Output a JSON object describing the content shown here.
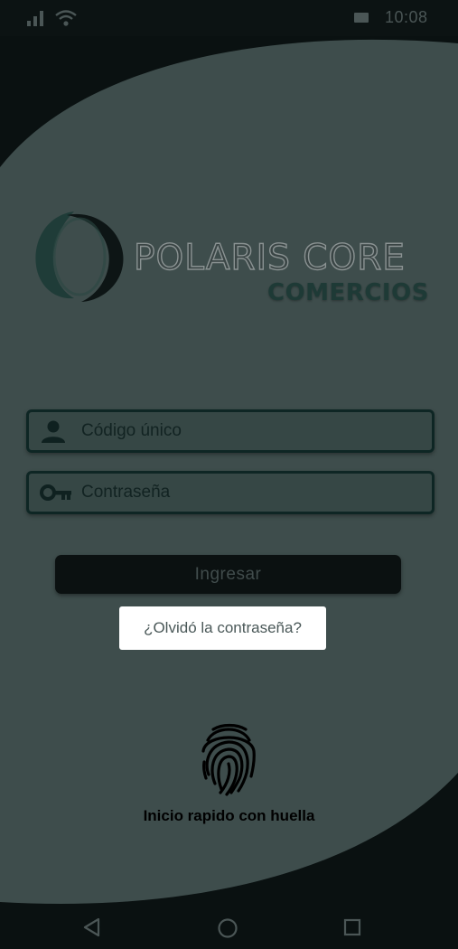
{
  "status_bar": {
    "time": "10:08",
    "signal_icon": "signal-icon",
    "wifi_icon": "wifi-icon",
    "battery_icon": "battery-icon"
  },
  "brand": {
    "title": "POLARIS CORE",
    "subtitle": "COMERCIOS",
    "logo_icon": "polaris-logo-icon"
  },
  "login_form": {
    "user_placeholder": "Código único",
    "user_icon": "person-icon",
    "password_placeholder": "Contraseña",
    "password_icon": "key-icon",
    "submit_label": "Ingresar",
    "forgot_label": "¿Olvidó la contraseña?"
  },
  "fingerprint": {
    "icon": "fingerprint-icon",
    "label": "Inicio rapido con huella"
  },
  "nav_bar": {
    "back_icon": "back-triangle-icon",
    "home_icon": "home-circle-icon",
    "recents_icon": "recents-square-icon"
  },
  "colors": {
    "background_dark": "#0a1111",
    "panel": "#3e4d4c",
    "field_border": "#0e2624",
    "button": "#0b1111",
    "forgot_bg": "#ffffff"
  }
}
